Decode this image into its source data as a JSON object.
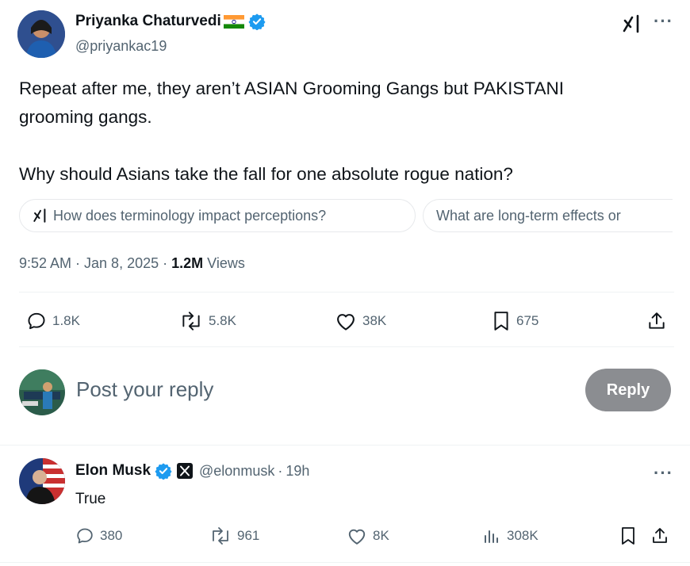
{
  "tweet": {
    "author_name": "Priyanka Chaturvedi",
    "author_handle": "@priyankac19",
    "text_lines": [
      "Repeat after me, they aren’t ASIAN Grooming Gangs but PAKISTANI",
      "grooming gangs."
    ],
    "text_line_3": "Why should Asians take the fall for one absolute rogue nation?",
    "grok_chips": [
      "How does terminology impact perceptions?",
      "What are long-term effects or"
    ],
    "timestamp": "9:52 AM · Jan 8, 2025 · ",
    "views_count": "1.2M",
    "views_label": " Views",
    "actions": {
      "replies": "1.8K",
      "reposts": "5.8K",
      "likes": "38K",
      "bookmarks": "675"
    }
  },
  "composer": {
    "placeholder": "Post your reply",
    "reply_label": "Reply"
  },
  "reply": {
    "author_name": "Elon Musk",
    "author_handle": "@elonmusk",
    "separator": "·",
    "age": "19h",
    "text": "True",
    "actions": {
      "replies": "380",
      "reposts": "961",
      "likes": "8K",
      "views": "308K"
    }
  },
  "icons": {
    "more": "more-horizontal-icon",
    "grok": "grok-icon",
    "verified": "verified-badge-icon",
    "flag": "india-flag-icon"
  },
  "colors": {
    "verified_blue": "#1d9bf0",
    "secondary_text": "#536471",
    "reply_button_bg": "#8b8d91"
  },
  "more_glyph": "···"
}
